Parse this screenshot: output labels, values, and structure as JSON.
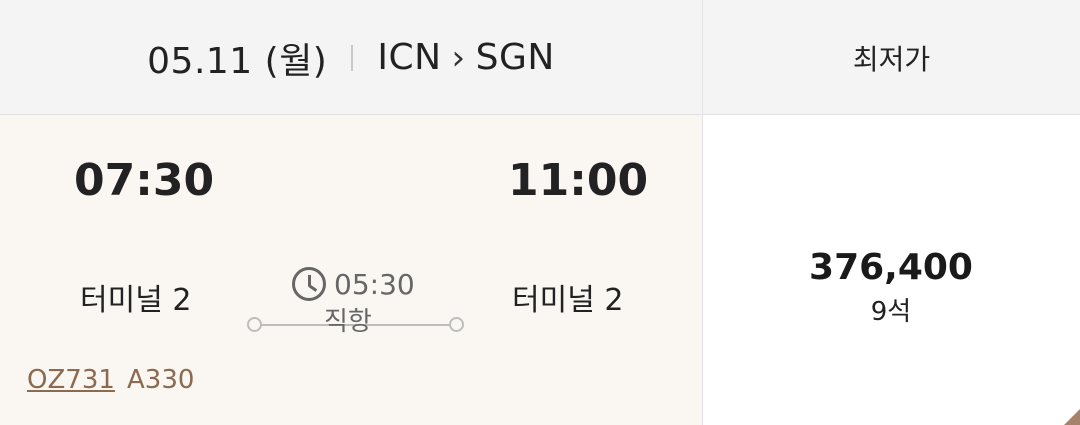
{
  "header": {
    "date": "05.11 (월)",
    "origin": "ICN",
    "arrow": "›",
    "destination": "SGN",
    "fare_column_title": "최저가"
  },
  "flight": {
    "departure_time": "07:30",
    "arrival_time": "11:00",
    "departure_terminal": "터미널 2",
    "arrival_terminal": "터미널 2",
    "duration": "05:30",
    "stop_type": "직항",
    "flight_number": "OZ731",
    "aircraft": "A330",
    "icons": {
      "duration": "clock-icon"
    }
  },
  "fare": {
    "price": "376,400",
    "seats": "9석"
  },
  "colors": {
    "header_bg": "#f4f4f4",
    "flight_bg": "#faf6f2",
    "accent_brown": "#8b6a4f"
  }
}
